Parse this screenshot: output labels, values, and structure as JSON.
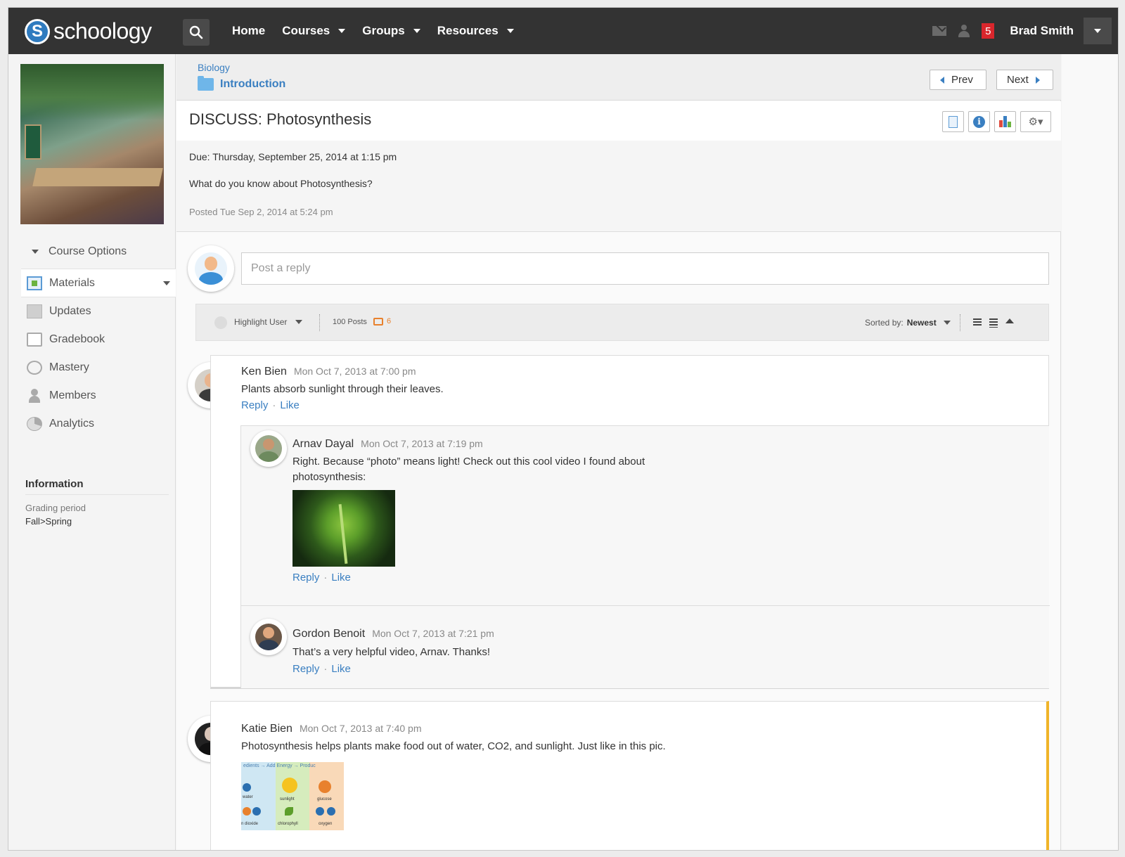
{
  "app": {
    "logo_mark": "S",
    "logo_text": "schoology"
  },
  "topnav": {
    "items": [
      "Home",
      "Courses",
      "Groups",
      "Resources"
    ],
    "notification_count": "5",
    "user_name": "Brad Smith"
  },
  "sidebar": {
    "course_options": "Course Options",
    "items": [
      {
        "label": "Materials",
        "icon": "materials-icon"
      },
      {
        "label": "Updates",
        "icon": "updates-icon"
      },
      {
        "label": "Gradebook",
        "icon": "gradebook-icon"
      },
      {
        "label": "Mastery",
        "icon": "mastery-icon"
      },
      {
        "label": "Members",
        "icon": "members-icon"
      },
      {
        "label": "Analytics",
        "icon": "analytics-icon"
      }
    ],
    "info_title": "Information",
    "grading_label": "Grading period",
    "grading_value": "Fall>Spring"
  },
  "breadcrumb": {
    "course": "Biology",
    "folder": "Introduction",
    "prev": "Prev",
    "next": "Next"
  },
  "discussion": {
    "title": "DISCUSS: Photosynthesis",
    "due": "Due: Thursday, September 25, 2014 at 1:15 pm",
    "question": "What do you know about Photosynthesis?",
    "posted": "Posted Tue Sep 2, 2014 at 5:24 pm",
    "reply_placeholder": "Post a reply"
  },
  "filters": {
    "highlight_user": "Highlight User",
    "posts": "100 Posts",
    "new_posts": "6",
    "sorted_label": "Sorted by:",
    "sorted_value": "Newest"
  },
  "comments": [
    {
      "author": "Ken Bien",
      "time": "Mon Oct 7, 2013 at 7:00 pm",
      "text": "Plants absorb sunlight through their leaves."
    },
    {
      "author": "Arnav Dayal",
      "time": "Mon Oct 7, 2013 at 7:19 pm",
      "text": "Right. Because “photo” means light! Check out this cool video I found about photosynthesis:"
    },
    {
      "author": "Gordon Benoit",
      "time": "Mon Oct 7, 2013 at 7:21 pm",
      "text": "That’s a very helpful video, Arnav. Thanks!"
    },
    {
      "author": "Katie Bien",
      "time": "Mon Oct 7, 2013 at 7:40 pm",
      "text": "Photosynthesis helps plants make food out of water, CO2, and sunlight. Just like in this pic."
    }
  ],
  "actions": {
    "reply": "Reply",
    "like": "Like",
    "sep": "·"
  },
  "diagram": {
    "header": "edients → Add Energy → Produc",
    "labels": [
      "water",
      "sunlight",
      "glucose",
      "n dioxide",
      "chlorophyll",
      "oxygen"
    ]
  },
  "colors": {
    "topbar": "#333333",
    "link": "#3a7fc1",
    "badge": "#d9262c",
    "accent_new": "#e8812d",
    "highlight_border": "#f0b429"
  }
}
